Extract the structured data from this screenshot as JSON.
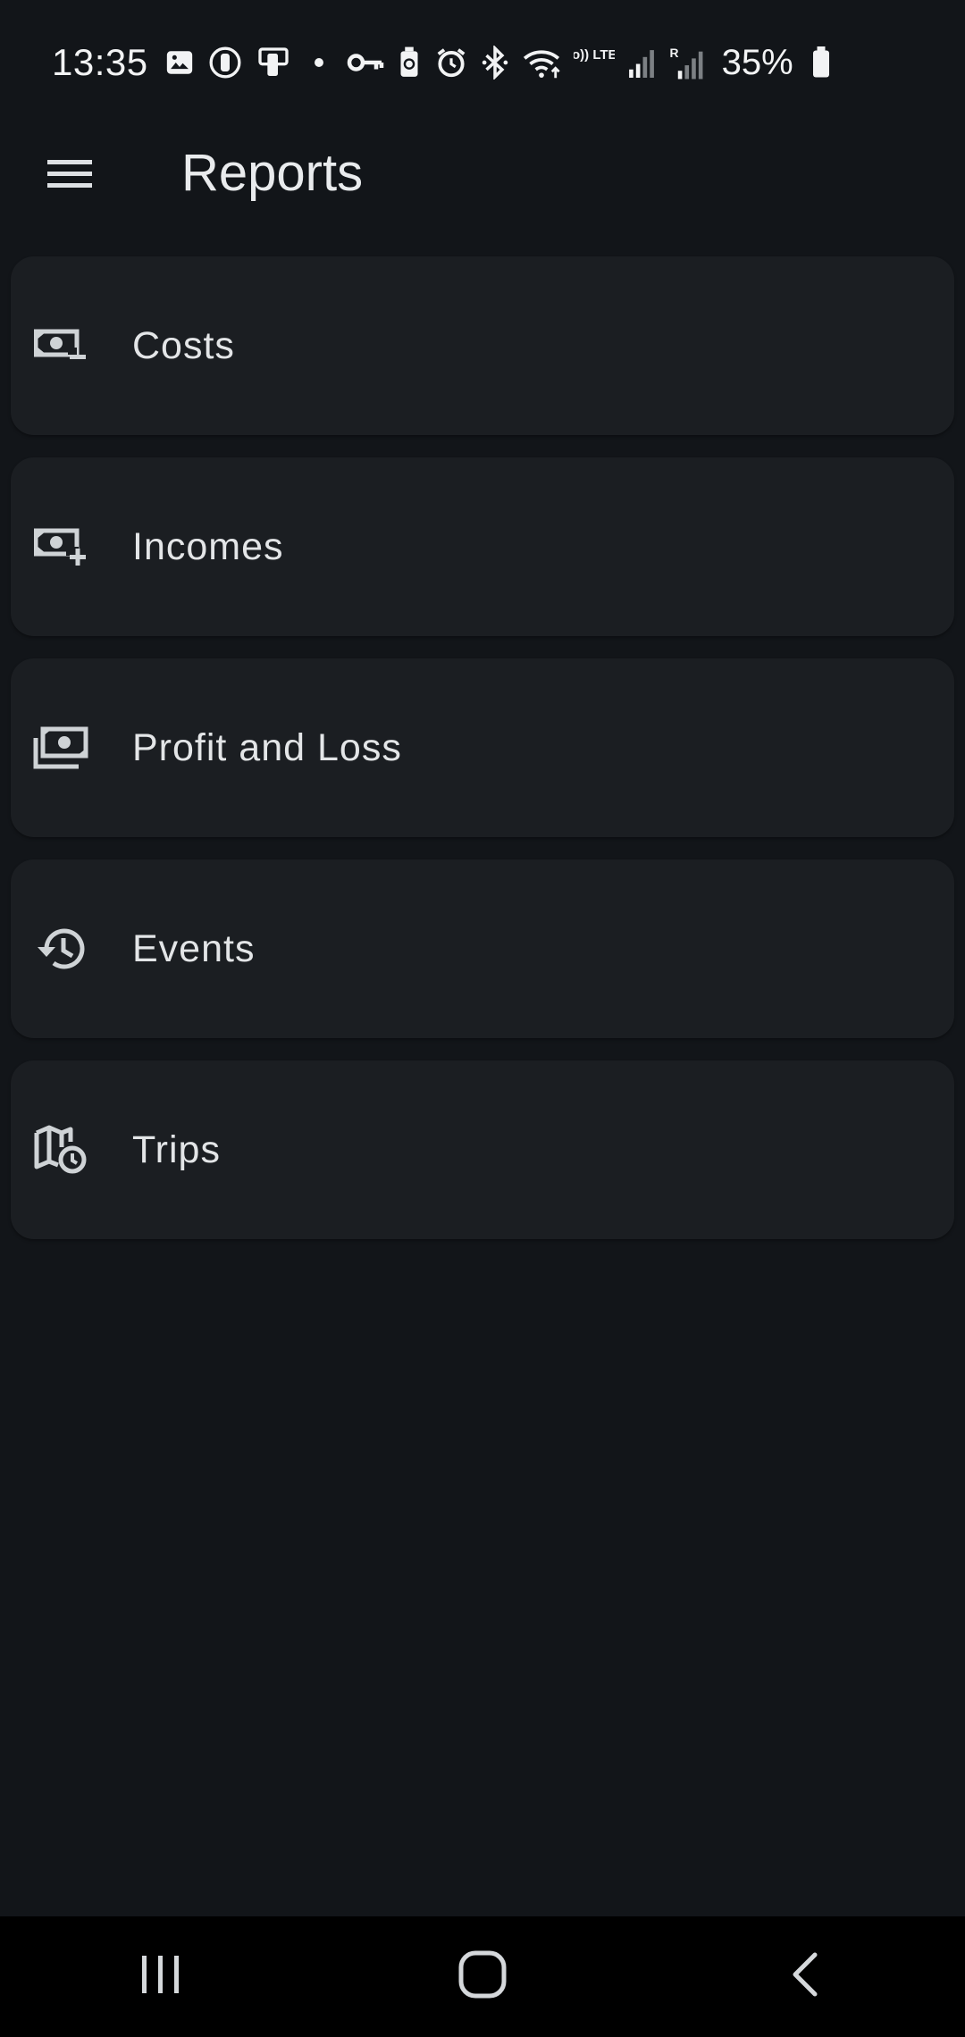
{
  "status_bar": {
    "time": "13:35",
    "battery_percent": "35%",
    "network_label": "Vo)) LTE1",
    "roaming_label": "R",
    "icons": [
      "gallery-icon",
      "nfc-icon",
      "cast-icon",
      "dot-icon",
      "vpn-key-icon",
      "battery-saver-icon",
      "alarm-icon",
      "bluetooth-icon",
      "wifi-icon",
      "volte-icon",
      "signal-icon",
      "signal-roaming-icon",
      "battery-icon"
    ]
  },
  "app_bar": {
    "title": "Reports",
    "menu_icon": "hamburger-menu-icon"
  },
  "reports": [
    {
      "label": "Costs",
      "icon": "money-minus-icon"
    },
    {
      "label": "Incomes",
      "icon": "money-plus-icon"
    },
    {
      "label": "Profit and Loss",
      "icon": "payments-icon"
    },
    {
      "label": "Events",
      "icon": "history-icon"
    },
    {
      "label": "Trips",
      "icon": "map-clock-icon"
    }
  ],
  "nav_bar": {
    "buttons": [
      "recents-icon",
      "home-icon",
      "back-icon"
    ]
  },
  "colors": {
    "background": "#121519",
    "card": "#1b1e22",
    "text": "#e3e5e7",
    "icon": "#cfd3d6",
    "nav_bar": "#000000"
  }
}
